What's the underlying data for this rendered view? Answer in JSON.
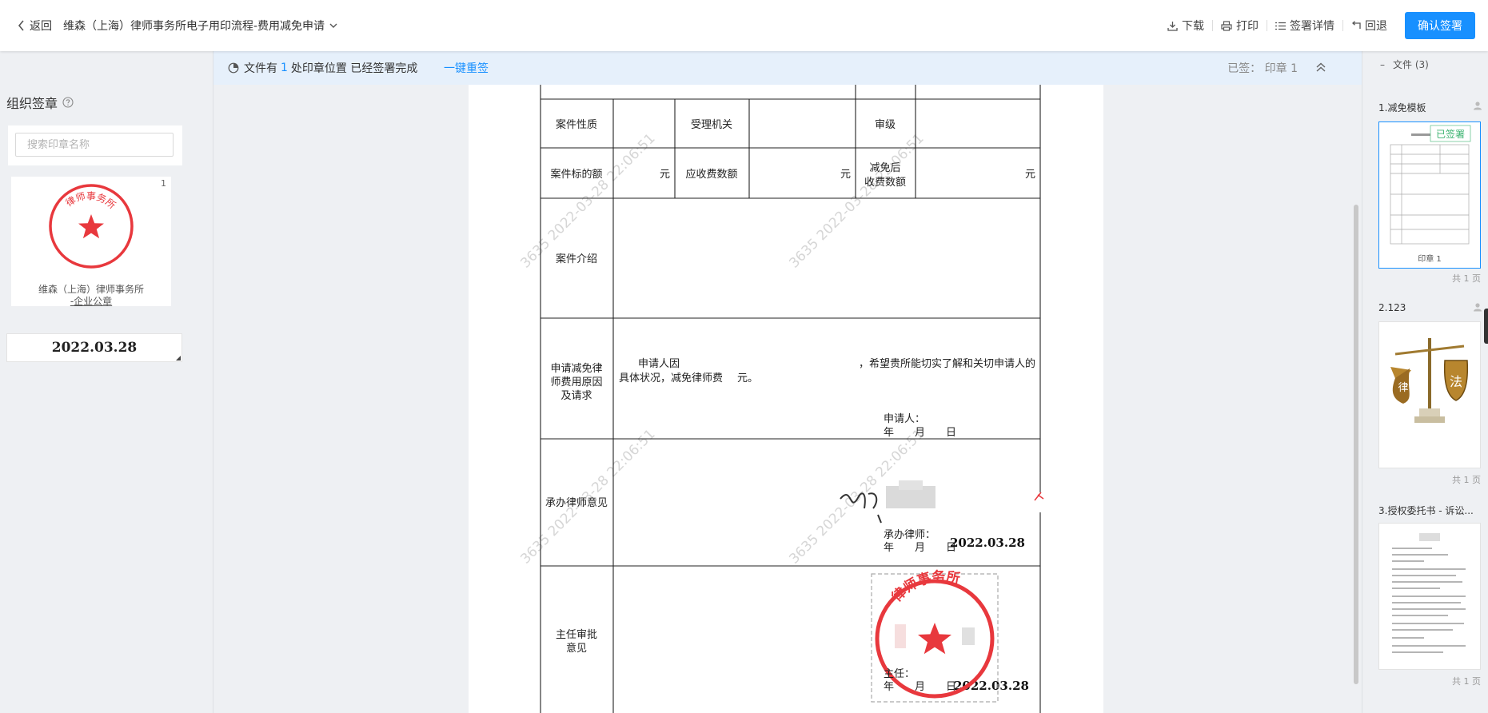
{
  "header": {
    "back_label": "返回",
    "title": "维森（上海）律师事务所电子用印流程-费用减免申请",
    "download_label": "下载",
    "print_label": "打印",
    "detail_label": "签署详情",
    "undo_label": "回退",
    "confirm_label": "确认签署"
  },
  "left_panel": {
    "title": "组织签章",
    "search_placeholder": "搜索印章名称",
    "seal": {
      "count": "1",
      "name_line1": "维森（上海）律师事务所",
      "name_line2": "-企业公章",
      "stamp_text": "律师事务所"
    },
    "date_stamp": "2022.03.28"
  },
  "notification": {
    "prefix": "文件有",
    "count": "1",
    "suffix": "处印章位置 已经签署完成",
    "resign_link": "一键重签",
    "signed_status": "已签： 印章 1"
  },
  "document": {
    "watermark": "3635 2022-03-28 22:06:51",
    "rows": {
      "case_nature": "案件性质",
      "accepting_agency": "受理机关",
      "trial_level": "审级",
      "case_amount": "案件标的额",
      "receivable_fee": "应收费数额",
      "reduced_fee_line1": "减免后",
      "reduced_fee_line2": "收费数额",
      "yuan": "元",
      "case_intro": "案件介绍",
      "reason_line1": "申请减免律",
      "reason_line2": "师费用原因",
      "reason_line3": "及请求",
      "reason_text1": "申请人因",
      "reason_text2": "，希望贵所能切实了解和关切申请人的",
      "reason_text3": "具体状况，减免律师费",
      "reason_text4": "元。",
      "applicant": "申请人：",
      "ymd": "年　　月　　日",
      "lawyer_opinion": "承办律师意见",
      "lawyer_label": "承办律师：",
      "lawyer_date": "2022.03.28",
      "director_line1": "主任审批",
      "director_line2": "意见",
      "director_label": "主任：",
      "director_date": "2022.03.28",
      "stamp_text": "律师事务所"
    }
  },
  "right_panel": {
    "header": "文件 (3)",
    "files": [
      {
        "name": "1.减免模板",
        "badge": "已签署",
        "caption": "印章 1",
        "pages": "共 1 页"
      },
      {
        "name": "2.123",
        "pages": "共 1 页"
      },
      {
        "name": "3.授权委托书 - 诉讼...",
        "pages": "共 1 页"
      }
    ]
  },
  "colors": {
    "accent": "#1890ff",
    "stamp_red": "#e8383d",
    "notice_bg": "#e6f0fb",
    "signed_green": "#3cb371"
  }
}
